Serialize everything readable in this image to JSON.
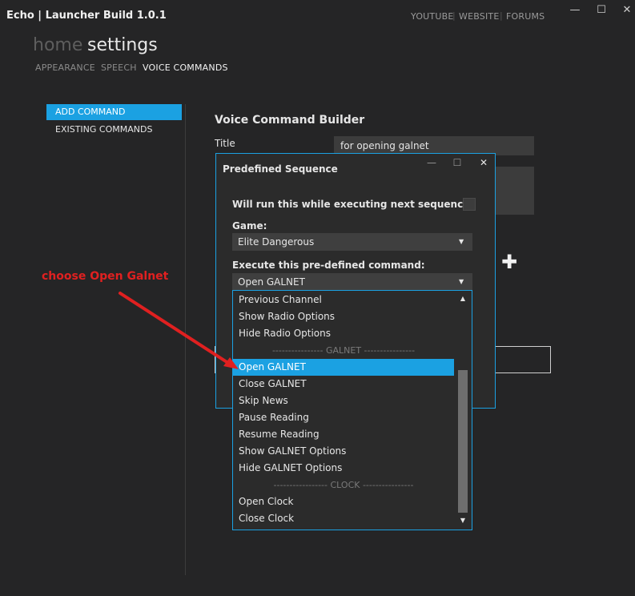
{
  "app": {
    "title": "Echo | Launcher Build 1.0.1",
    "links": [
      "YOUTUBE",
      "WEBSITE",
      "FORUMS"
    ],
    "link_separator": "|",
    "window_buttons": {
      "minimize": "—",
      "maximize": "☐",
      "close": "✕"
    }
  },
  "nav": {
    "home": "home",
    "settings": "settings",
    "tabs": [
      {
        "label": "APPEARANCE",
        "active": false
      },
      {
        "label": "SPEECH",
        "active": false
      },
      {
        "label": "VOICE COMMANDS",
        "active": true
      }
    ]
  },
  "sidebar": {
    "items": [
      {
        "label": "ADD COMMAND",
        "active": true
      },
      {
        "label": "EXISTING COMMANDS",
        "active": false
      }
    ]
  },
  "builder": {
    "heading": "Voice Command Builder",
    "title_label": "Title",
    "title_value": "for opening galnet",
    "add_icon": "✚"
  },
  "dialog": {
    "title": "Predefined Sequence",
    "buttons": {
      "minimize": "—",
      "maximize": "☐",
      "close": "✕"
    },
    "next_sequence_label": "Will run this while executing next sequence:",
    "next_sequence_checked": false,
    "game_label": "Game:",
    "game_value": "Elite Dangerous",
    "command_label": "Execute this pre-defined command:",
    "command_value": "Open GALNET"
  },
  "dropdown": {
    "items": [
      {
        "label": "Previous Channel",
        "kind": "item"
      },
      {
        "label": "Show Radio Options",
        "kind": "item"
      },
      {
        "label": "Hide Radio Options",
        "kind": "item"
      },
      {
        "label": "---------------- GALNET ----------------",
        "kind": "separator"
      },
      {
        "label": "Open GALNET",
        "kind": "item",
        "selected": true
      },
      {
        "label": "Close GALNET",
        "kind": "item"
      },
      {
        "label": "Skip News",
        "kind": "item"
      },
      {
        "label": "Pause Reading",
        "kind": "item"
      },
      {
        "label": "Resume Reading",
        "kind": "item"
      },
      {
        "label": "Show GALNET Options",
        "kind": "item"
      },
      {
        "label": "Hide GALNET Options",
        "kind": "item"
      },
      {
        "label": "----------------- CLOCK ----------------",
        "kind": "separator"
      },
      {
        "label": "Open Clock",
        "kind": "item"
      },
      {
        "label": "Close Clock",
        "kind": "item"
      }
    ],
    "scroll_up": "▲",
    "scroll_down": "▼"
  },
  "annotation": {
    "text": "choose Open Galnet",
    "color": "#e02020"
  },
  "colors": {
    "accent": "#1ba1e2",
    "background": "#252526",
    "annotation": "#e02020"
  },
  "combo_arrow": "▼"
}
